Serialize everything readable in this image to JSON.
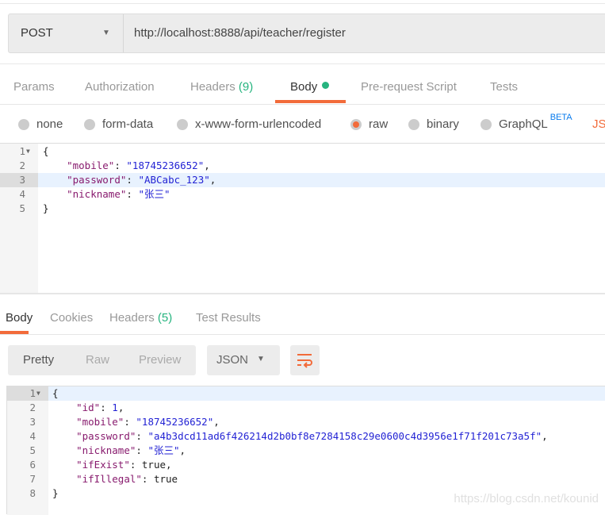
{
  "request": {
    "method": "POST",
    "url": "http://localhost:8888/api/teacher/register",
    "tabs": [
      {
        "label": "Params"
      },
      {
        "label": "Authorization"
      },
      {
        "label": "Headers",
        "count": "(9)"
      },
      {
        "label": "Body",
        "active": true
      },
      {
        "label": "Pre-request Script"
      },
      {
        "label": "Tests"
      }
    ],
    "body_types": [
      {
        "label": "none"
      },
      {
        "label": "form-data"
      },
      {
        "label": "x-www-form-urlencoded"
      },
      {
        "label": "raw",
        "selected": true
      },
      {
        "label": "binary"
      },
      {
        "label": "GraphQL",
        "badge": "BETA"
      },
      {
        "label": "JS"
      }
    ],
    "code": [
      [
        [
          "p",
          "{"
        ]
      ],
      [
        [
          "p",
          "    "
        ],
        [
          "k",
          "\"mobile\""
        ],
        [
          "p",
          ": "
        ],
        [
          "s",
          "\"18745236652\""
        ],
        [
          "p",
          ","
        ]
      ],
      [
        [
          "p",
          "    "
        ],
        [
          "k",
          "\"password\""
        ],
        [
          "p",
          ": "
        ],
        [
          "s",
          "\"ABCabc_123\""
        ],
        [
          "p",
          ","
        ]
      ],
      [
        [
          "p",
          "    "
        ],
        [
          "k",
          "\"nickname\""
        ],
        [
          "p",
          ": "
        ],
        [
          "s",
          "\"张三\""
        ]
      ],
      [
        [
          "p",
          "}"
        ]
      ]
    ],
    "highlight_line": 3
  },
  "response": {
    "tabs": [
      {
        "label": "Body",
        "active": true
      },
      {
        "label": "Cookies"
      },
      {
        "label": "Headers",
        "count": "(5)"
      },
      {
        "label": "Test Results"
      }
    ],
    "view_modes": [
      {
        "label": "Pretty",
        "active": true
      },
      {
        "label": "Raw"
      },
      {
        "label": "Preview"
      }
    ],
    "format": "JSON",
    "wrap_icon": "wrap-lines-icon",
    "code": [
      [
        [
          "p",
          "{"
        ]
      ],
      [
        [
          "p",
          "    "
        ],
        [
          "k",
          "\"id\""
        ],
        [
          "p",
          ": "
        ],
        [
          "n",
          "1"
        ],
        [
          "p",
          ","
        ]
      ],
      [
        [
          "p",
          "    "
        ],
        [
          "k",
          "\"mobile\""
        ],
        [
          "p",
          ": "
        ],
        [
          "s",
          "\"18745236652\""
        ],
        [
          "p",
          ","
        ]
      ],
      [
        [
          "p",
          "    "
        ],
        [
          "k",
          "\"password\""
        ],
        [
          "p",
          ": "
        ],
        [
          "s",
          "\"a4b3dcd11ad6f426214d2b0bf8e7284158c29e0600c4d3956e1f71f201c73a5f\""
        ],
        [
          "p",
          ","
        ]
      ],
      [
        [
          "p",
          "    "
        ],
        [
          "k",
          "\"nickname\""
        ],
        [
          "p",
          ": "
        ],
        [
          "s",
          "\"张三\""
        ],
        [
          "p",
          ","
        ]
      ],
      [
        [
          "p",
          "    "
        ],
        [
          "k",
          "\"ifExist\""
        ],
        [
          "p",
          ": true,"
        ]
      ],
      [
        [
          "p",
          "    "
        ],
        [
          "k",
          "\"ifIllegal\""
        ],
        [
          "p",
          ": true"
        ]
      ],
      [
        [
          "p",
          "}"
        ]
      ]
    ],
    "highlight_line": 1
  },
  "watermark": "https://blog.csdn.net/kounid",
  "colors": {
    "accent": "#f26b3a",
    "green": "#26b47f",
    "beta": "#097bed"
  }
}
